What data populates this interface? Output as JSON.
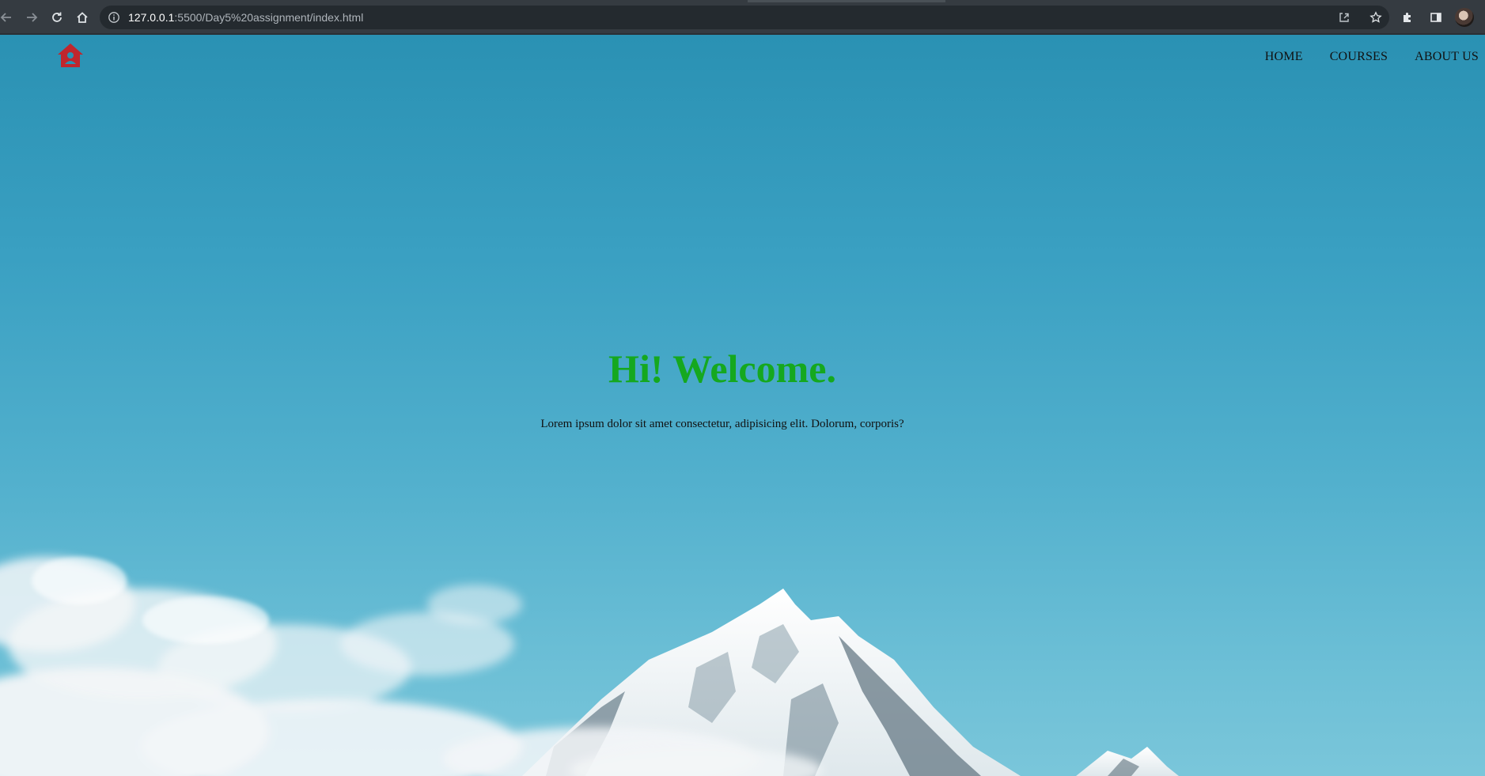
{
  "browser": {
    "url_host": "127.0.0.1",
    "url_path": ":5500/Day5%20assignment/index.html"
  },
  "icons": {
    "back": "arrow-left-icon",
    "forward": "arrow-right-icon",
    "reload": "reload-icon",
    "home": "home-icon",
    "info": "info-icon",
    "share": "share-icon",
    "bookmark": "star-icon",
    "extensions": "puzzle-icon",
    "sidepanel": "side-panel-icon",
    "logo": "house-user-icon"
  },
  "site": {
    "nav": [
      "HOME",
      "COURSES",
      "ABOUT US"
    ],
    "hero_title": "Hi! Welcome.",
    "hero_subtitle": "Lorem ipsum dolor sit amet consectetur, adipisicing elit. Dolorum, corporis?"
  },
  "colors": {
    "hero_title": "#15a81f",
    "logo": "#c0262d",
    "sky_top": "#2a91b3",
    "sky_bottom": "#7ac6da"
  }
}
